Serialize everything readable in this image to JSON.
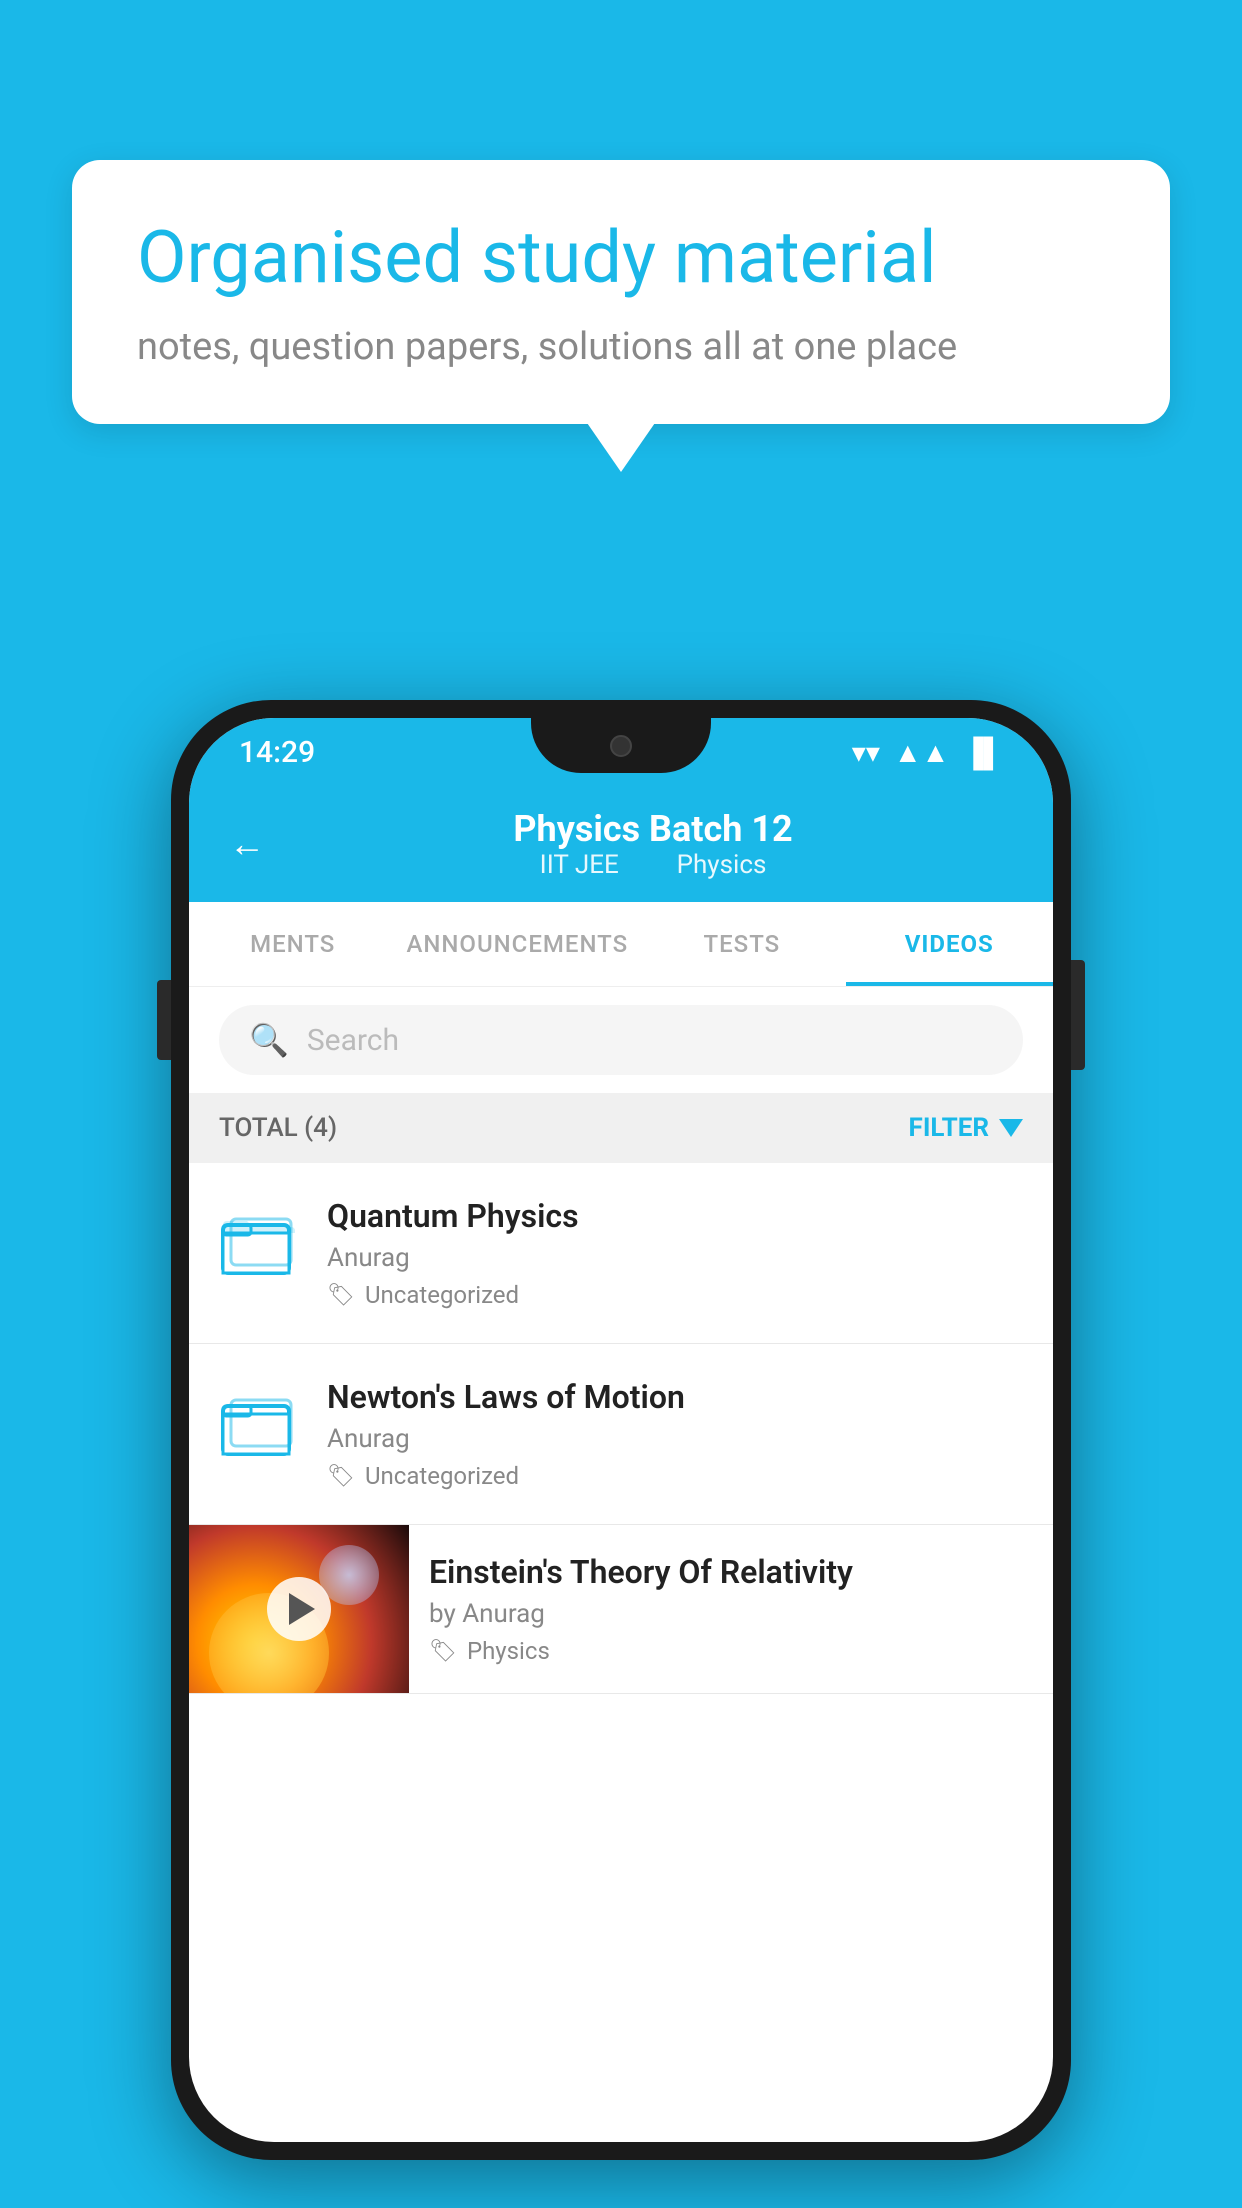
{
  "background_color": "#1ab8e8",
  "speech_bubble": {
    "title": "Organised study material",
    "subtitle": "notes, question papers, solutions all at one place"
  },
  "phone": {
    "status_bar": {
      "time": "14:29",
      "wifi": "▾",
      "signal": "▲",
      "battery": "▐"
    },
    "header": {
      "back_label": "←",
      "title": "Physics Batch 12",
      "tag1": "IIT JEE",
      "tag2": "Physics"
    },
    "tabs": [
      {
        "label": "MENTS",
        "active": false
      },
      {
        "label": "ANNOUNCEMENTS",
        "active": false
      },
      {
        "label": "TESTS",
        "active": false
      },
      {
        "label": "VIDEOS",
        "active": true
      }
    ],
    "search": {
      "placeholder": "Search"
    },
    "filter": {
      "total_label": "TOTAL (4)",
      "filter_label": "FILTER"
    },
    "list_items": [
      {
        "title": "Quantum Physics",
        "author": "Anurag",
        "tag": "Uncategorized",
        "type": "folder"
      },
      {
        "title": "Newton's Laws of Motion",
        "author": "Anurag",
        "tag": "Uncategorized",
        "type": "folder"
      },
      {
        "title": "Einstein's Theory Of Relativity",
        "author": "by Anurag",
        "tag": "Physics",
        "type": "video"
      }
    ]
  }
}
